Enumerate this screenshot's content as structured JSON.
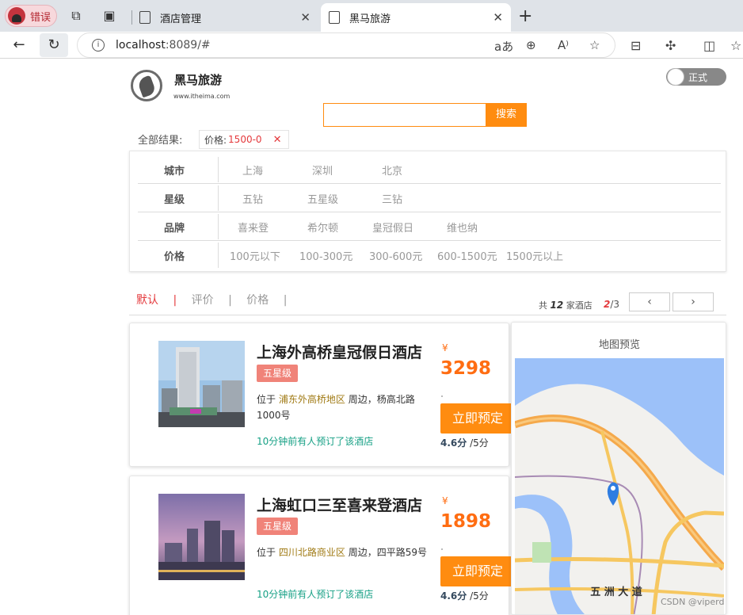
{
  "browser": {
    "error_label": "错误",
    "tabs": [
      {
        "title": "酒店管理",
        "active": false
      },
      {
        "title": "黑马旅游",
        "active": true
      }
    ],
    "url_host": "localhost",
    "url_rest": ":8089/#"
  },
  "header": {
    "brand": "黑马旅游",
    "brand_sub": "www.itheima.com",
    "env_toggle": "正式"
  },
  "search": {
    "placeholder": "",
    "button": "搜索"
  },
  "filters": {
    "all_results_label": "全部结果:",
    "active_tag_key": "价格:",
    "active_tag_value": "1500-0",
    "rows": [
      {
        "key": "城市",
        "options": [
          "上海",
          "深圳",
          "北京"
        ]
      },
      {
        "key": "星级",
        "options": [
          "五钻",
          "五星级",
          "三钻"
        ]
      },
      {
        "key": "品牌",
        "options": [
          "喜来登",
          "希尔顿",
          "皇冠假日",
          "维也纳"
        ]
      },
      {
        "key": "价格",
        "options": [
          "100元以下",
          "100-300元",
          "300-600元",
          "600-1500元",
          "1500元以上"
        ]
      }
    ]
  },
  "sort": {
    "options": [
      "默认",
      "评价",
      "价格"
    ],
    "total_prefix": "共",
    "total_count": "12",
    "total_suffix": "家酒店",
    "page_current": "2",
    "page_total": "/3"
  },
  "hotels": [
    {
      "name": "上海外高桥皇冠假日酒店",
      "star": "五星级",
      "addr_prefix": "位于",
      "business": "浦东外高桥地区",
      "addr_suffix": "周边，杨高北路1000号",
      "booked": "10分钟前有人预订了该酒店",
      "currency": "¥",
      "price": "3298",
      "book_label": "立即预定",
      "score": "4.6分",
      "score_max": "/5分"
    },
    {
      "name": "上海虹口三至喜来登酒店",
      "star": "五星级",
      "addr_prefix": "位于",
      "business": "四川北路商业区",
      "addr_suffix": "周边，四平路59号",
      "booked": "10分钟前有人预订了该酒店",
      "currency": "¥",
      "price": "1898",
      "book_label": "立即预定",
      "score": "4.6分",
      "score_max": "/5分"
    }
  ],
  "map": {
    "title": "地图预览",
    "road_label": "五 洲 大 道"
  },
  "watermark": "CSDN @viperd"
}
